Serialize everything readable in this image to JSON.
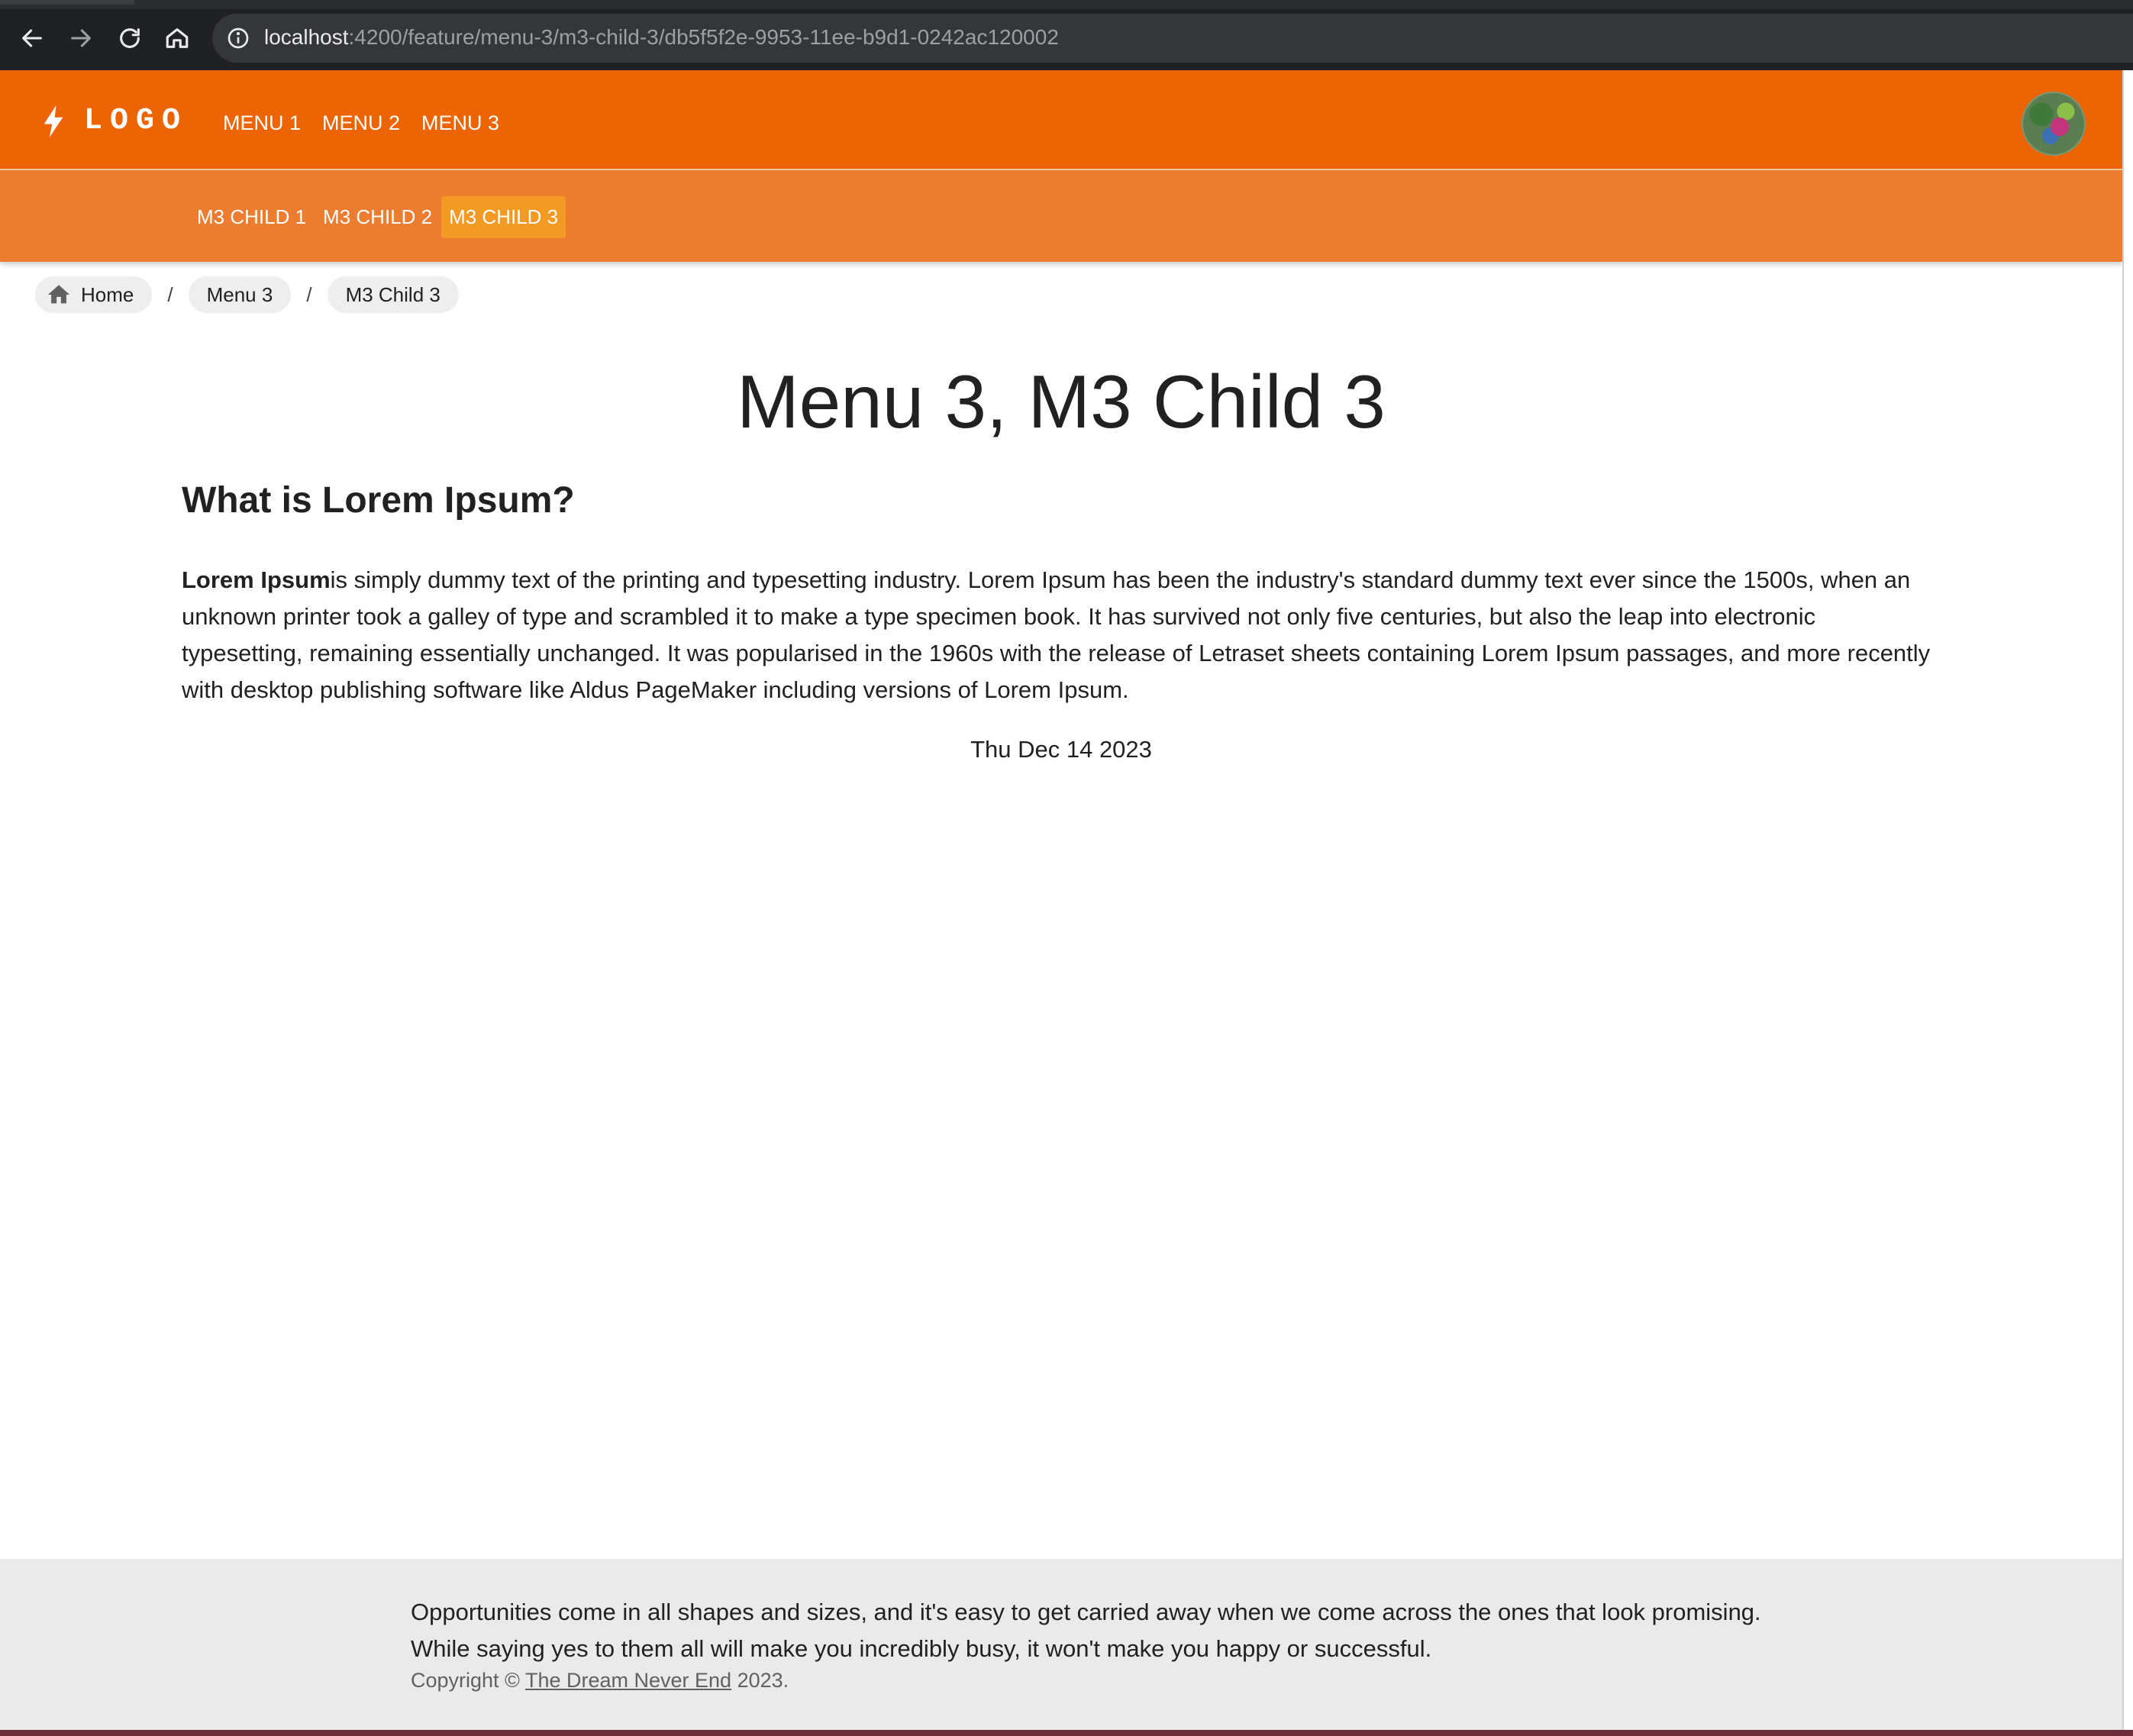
{
  "browser": {
    "url_host": "localhost",
    "url_path": ":4200/feature/menu-3/m3-child-3/db5f5f2e-9953-11ee-b9d1-0242ac120002"
  },
  "toolbar": {
    "logo_text": "LOGO",
    "menus": [
      "MENU 1",
      "MENU 2",
      "MENU 3"
    ]
  },
  "subbar": {
    "items": [
      "M3 CHILD 1",
      "M3 CHILD 2",
      "M3 CHILD 3"
    ],
    "active": "M3 CHILD 3"
  },
  "breadcrumb": {
    "items": [
      "Home",
      "Menu 3",
      "M3 Child 3"
    ],
    "separator": "/"
  },
  "main": {
    "title": "Menu 3, M3 Child 3",
    "heading": "What is Lorem Ipsum?",
    "paragraph_bold": "Lorem Ipsum",
    "paragraph_rest": "is simply dummy text of the printing and typesetting industry. Lorem Ipsum has been the industry's standard dummy text ever since the 1500s, when an unknown printer took a galley of type and scrambled it to make a type specimen book. It has survived not only five centuries, but also the leap into electronic typesetting, remaining essentially unchanged. It was popularised in the 1960s with the release of Letraset sheets containing Lorem Ipsum passages, and more recently with desktop publishing software like Aldus PageMaker including versions of Lorem Ipsum.",
    "date": "Thu Dec 14 2023"
  },
  "footer": {
    "quote": "Opportunities come in all shapes and sizes, and it's easy to get carried away when we come across the ones that look promising. While saying yes to them all will make you incredibly busy, it won't make you happy or successful.",
    "copyright_prefix": "Copyright ©",
    "copyright_link": "The Dream Never End",
    "copyright_year": "2023."
  },
  "colors": {
    "toolbar": "#ec6404",
    "subbar": "#ec7d30",
    "active_sub": "#f39a25",
    "footer": "#eaeaea"
  },
  "icons": {
    "back": "arrow-left-icon",
    "forward": "arrow-right-icon",
    "reload": "reload-icon",
    "home_browser": "home-icon",
    "info": "info-icon",
    "logo": "bolt-icon",
    "breadcrumb_home": "home-icon"
  }
}
